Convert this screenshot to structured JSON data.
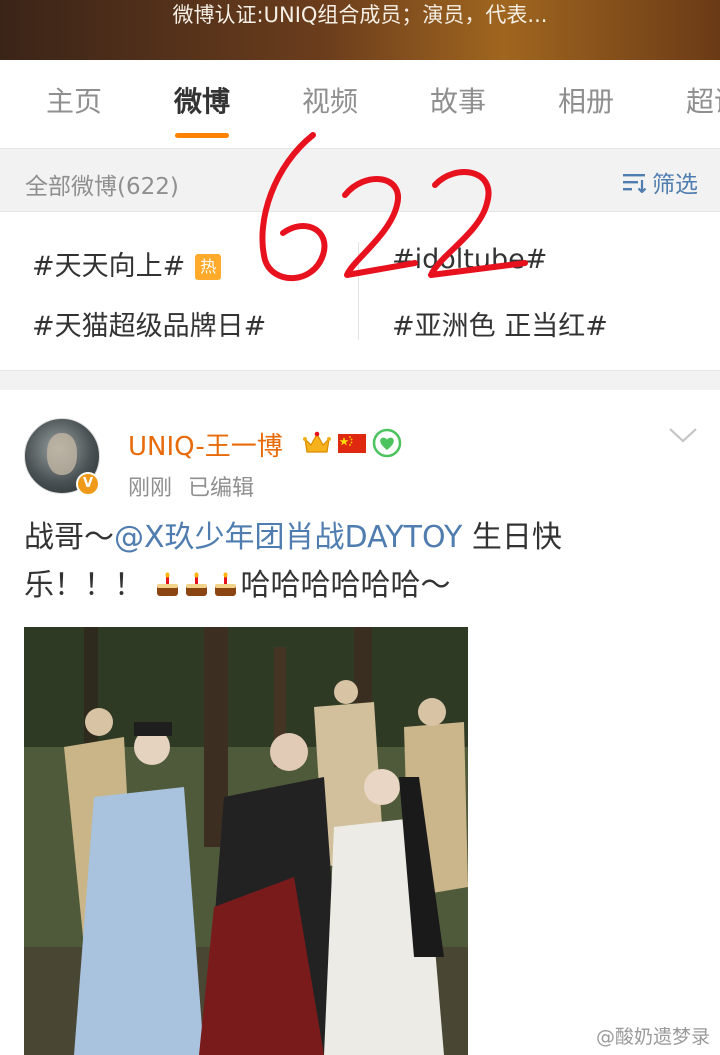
{
  "banner": {
    "text": "微博认证:UNIQ组合成员；演员，代表..."
  },
  "tabs": [
    {
      "label": "主页"
    },
    {
      "label": "微博",
      "active": true
    },
    {
      "label": "视频"
    },
    {
      "label": "故事"
    },
    {
      "label": "相册"
    },
    {
      "label": "超话"
    }
  ],
  "filter_bar": {
    "count_label": "全部微博(622)",
    "filter_label": "筛选"
  },
  "topics": [
    {
      "label": "#天天向上#",
      "badge": "热"
    },
    {
      "label": "#idoltube#"
    },
    {
      "label": "#天猫超级品牌日#"
    },
    {
      "label": "#亚洲色 正当红#"
    }
  ],
  "annotation": {
    "text": "622",
    "color": "#e8121f"
  },
  "post": {
    "username": "UNIQ-王一博",
    "verified_badge": "V",
    "time": "刚刚",
    "edited": "已编辑",
    "text_prefix": "战哥～",
    "mention": "@X玖少年团肖战DAYTOY",
    "text_mid": " 生日快乐！！！",
    "text_suffix": "哈哈哈哈哈哈～",
    "icons": [
      "crown-icon",
      "china-flag-icon",
      "green-heart-icon",
      "cake-icon",
      "chevron-down-icon",
      "filter-icon"
    ]
  },
  "watermark": {
    "text": "@酸奶遗梦录"
  },
  "colors": {
    "accent": "#ff8200",
    "link": "#507daf",
    "username": "#e86b0a"
  }
}
